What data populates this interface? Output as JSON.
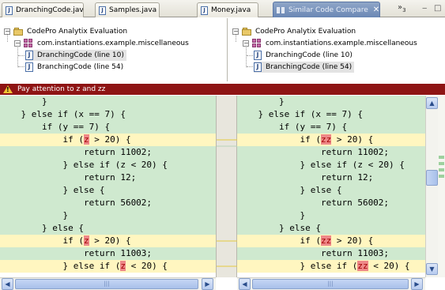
{
  "tabs": [
    {
      "label": "DranchingCode.java",
      "icon": "java-file-icon"
    },
    {
      "label": "Samples.java",
      "icon": "java-file-icon"
    },
    {
      "label": "Money.java",
      "icon": "java-file-icon"
    },
    {
      "label": "Similar Code Compare",
      "icon": "compare-icon",
      "active": true
    }
  ],
  "tab_overflow": {
    "symbol": "»",
    "count": "3"
  },
  "window_controls": {
    "minimize": "‒",
    "maximize": "□"
  },
  "left_tree": {
    "project": "CodePro Analytix Evaluation",
    "package": "com.instantiations.example.miscellaneous",
    "items": [
      "DranchingCode (line 10)",
      "BranchingCode (line 54)"
    ],
    "selected_index": 0
  },
  "right_tree": {
    "project": "CodePro Analytix Evaluation",
    "package": "com.instantiations.example.miscellaneous",
    "items": [
      "DranchingCode (line 10)",
      "BranchingCode (line 54)"
    ],
    "selected_index": 1
  },
  "warning": {
    "icon": "warning-icon",
    "text": "Pay attention to z and zz"
  },
  "left_code": [
    {
      "pre": "        }",
      "bg": "g"
    },
    {
      "pre": "    } else if (x == 7) {",
      "bg": "g"
    },
    {
      "pre": "        if (y == 7) {",
      "bg": "g"
    },
    {
      "pre": "            if (",
      "hl": "z",
      "post": " > 20) {",
      "bg": "y"
    },
    {
      "pre": "                return 11002;",
      "bg": "g"
    },
    {
      "pre": "            } else if (z < 20) {",
      "bg": "g"
    },
    {
      "pre": "                return 12;",
      "bg": "g"
    },
    {
      "pre": "            } else {",
      "bg": "g"
    },
    {
      "pre": "                return 56002;",
      "bg": "g"
    },
    {
      "pre": "            }",
      "bg": "g"
    },
    {
      "pre": "        } else {",
      "bg": "g"
    },
    {
      "pre": "            if (",
      "hl": "z",
      "post": " > 20) {",
      "bg": "y"
    },
    {
      "pre": "                return 11003;",
      "bg": "g"
    },
    {
      "pre": "            } else if (",
      "hl": "z",
      "post": " < 20) {",
      "bg": "y"
    }
  ],
  "right_code": [
    {
      "pre": "        }",
      "bg": "g"
    },
    {
      "pre": "    } else if (x == 7) {",
      "bg": "g"
    },
    {
      "pre": "        if (y == 7) {",
      "bg": "g"
    },
    {
      "pre": "            if (",
      "hl": "zz",
      "post": " > 20) {",
      "bg": "y"
    },
    {
      "pre": "                return 11002;",
      "bg": "g"
    },
    {
      "pre": "            } else if (z < 20) {",
      "bg": "g"
    },
    {
      "pre": "                return 12;",
      "bg": "g"
    },
    {
      "pre": "            } else {",
      "bg": "g"
    },
    {
      "pre": "                return 56002;",
      "bg": "g"
    },
    {
      "pre": "            }",
      "bg": "g"
    },
    {
      "pre": "        } else {",
      "bg": "g"
    },
    {
      "pre": "            if (",
      "hl": "zz",
      "post": " > 20) {",
      "bg": "y"
    },
    {
      "pre": "                return 11003;",
      "bg": "g"
    },
    {
      "pre": "            } else if (",
      "hl": "zz",
      "post": " < 20) {",
      "bg": "y"
    }
  ],
  "scroll": {
    "up": "▲",
    "down": "▼",
    "left": "◀",
    "right": "▶",
    "grip": "|||"
  },
  "colors": {
    "warning_bar": "#8e1414",
    "match_green": "#cfe9cf",
    "diff_yellow": "#fff6c0",
    "diff_highlight": "#ee8888"
  }
}
